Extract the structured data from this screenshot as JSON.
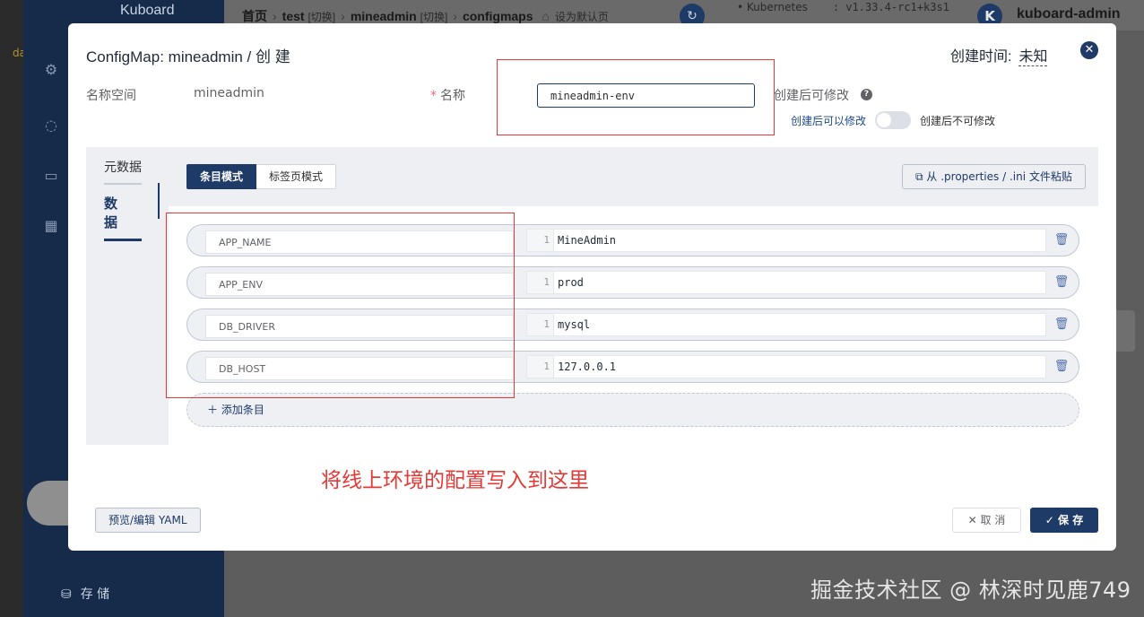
{
  "background": {
    "brand": "Kuboard",
    "side_tag": "da",
    "breadcrumb": [
      {
        "label": "首页"
      },
      {
        "label": "test",
        "switch": "[切换]"
      },
      {
        "label": "mineadmin",
        "switch": "[切换]"
      },
      {
        "label": "configmaps"
      }
    ],
    "set_default": "设为默认页",
    "k8s_label": "Kubernetes",
    "k8s_version": "v1.33.4-rc1+k3s1",
    "avatar_letter": "K",
    "user": "kuboard-admin",
    "side_storage": "存 储"
  },
  "modal": {
    "title": "ConfigMap: mineadmin / 创 建",
    "created_label": "创建时间:",
    "created_value": "未知",
    "namespace_label": "名称空间",
    "namespace_value": "mineadmin",
    "name_label": "名称",
    "name_value": "mineadmin-env",
    "immutable_label": "创建后可修改",
    "toggle_on_label": "创建后可以修改",
    "toggle_off_label": "创建后不可修改",
    "tabs": {
      "metadata": "元数据",
      "data": "数 据"
    },
    "modes": {
      "entry": "条目模式",
      "tab": "标签页模式"
    },
    "paste_button": "从 .properties / .ini 文件粘贴",
    "entries": [
      {
        "key": "APP_NAME",
        "line": "1",
        "value": "MineAdmin"
      },
      {
        "key": "APP_ENV",
        "line": "1",
        "value": "prod"
      },
      {
        "key": "DB_DRIVER",
        "line": "1",
        "value": "mysql"
      },
      {
        "key": "DB_HOST",
        "line": "1",
        "value": "127.0.0.1"
      }
    ],
    "add_entry": "添加条目",
    "annotation": "将线上环境的配置写入到这里",
    "yaml_button": "预览/编辑 YAML",
    "cancel_button": "取 消",
    "save_button": "保 存"
  },
  "watermark": "掘金技术社区 @ 林深时见鹿749",
  "colors": {
    "primary": "#1e3a66",
    "annotation_red": "#e53935",
    "panel_bg": "#edeff3"
  }
}
